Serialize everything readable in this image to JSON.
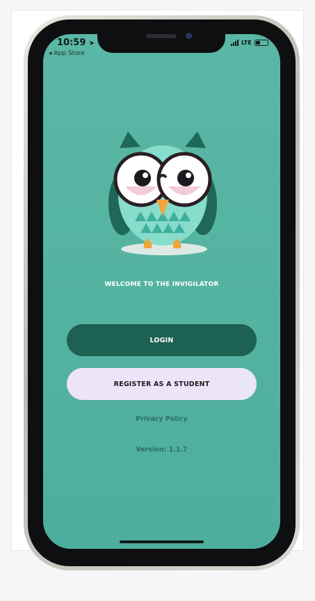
{
  "status_bar": {
    "time": "10:59",
    "network": "LTE"
  },
  "back_nav": {
    "label": "App Store"
  },
  "welcome": {
    "text": "WELCOME TO THE INVIGILATOR"
  },
  "buttons": {
    "login_label": "LOGIN",
    "register_label": "REGISTER AS A STUDENT"
  },
  "footer": {
    "privacy_label": "Privacy Policy",
    "version_text": "Version: 1.1.7"
  },
  "battery": {
    "level_fraction": 0.4
  },
  "colors": {
    "screen_bg": "#55b3a2",
    "login_button": "#1c6152",
    "register_button": "#ece5f8",
    "footer_text": "#2b6f62"
  },
  "icons": {
    "app_logo": "owl-with-glasses-icon",
    "location": "location-arrow-icon",
    "back": "back-arrow-icon",
    "signal": "signal-bars-icon",
    "battery": "battery-icon"
  }
}
